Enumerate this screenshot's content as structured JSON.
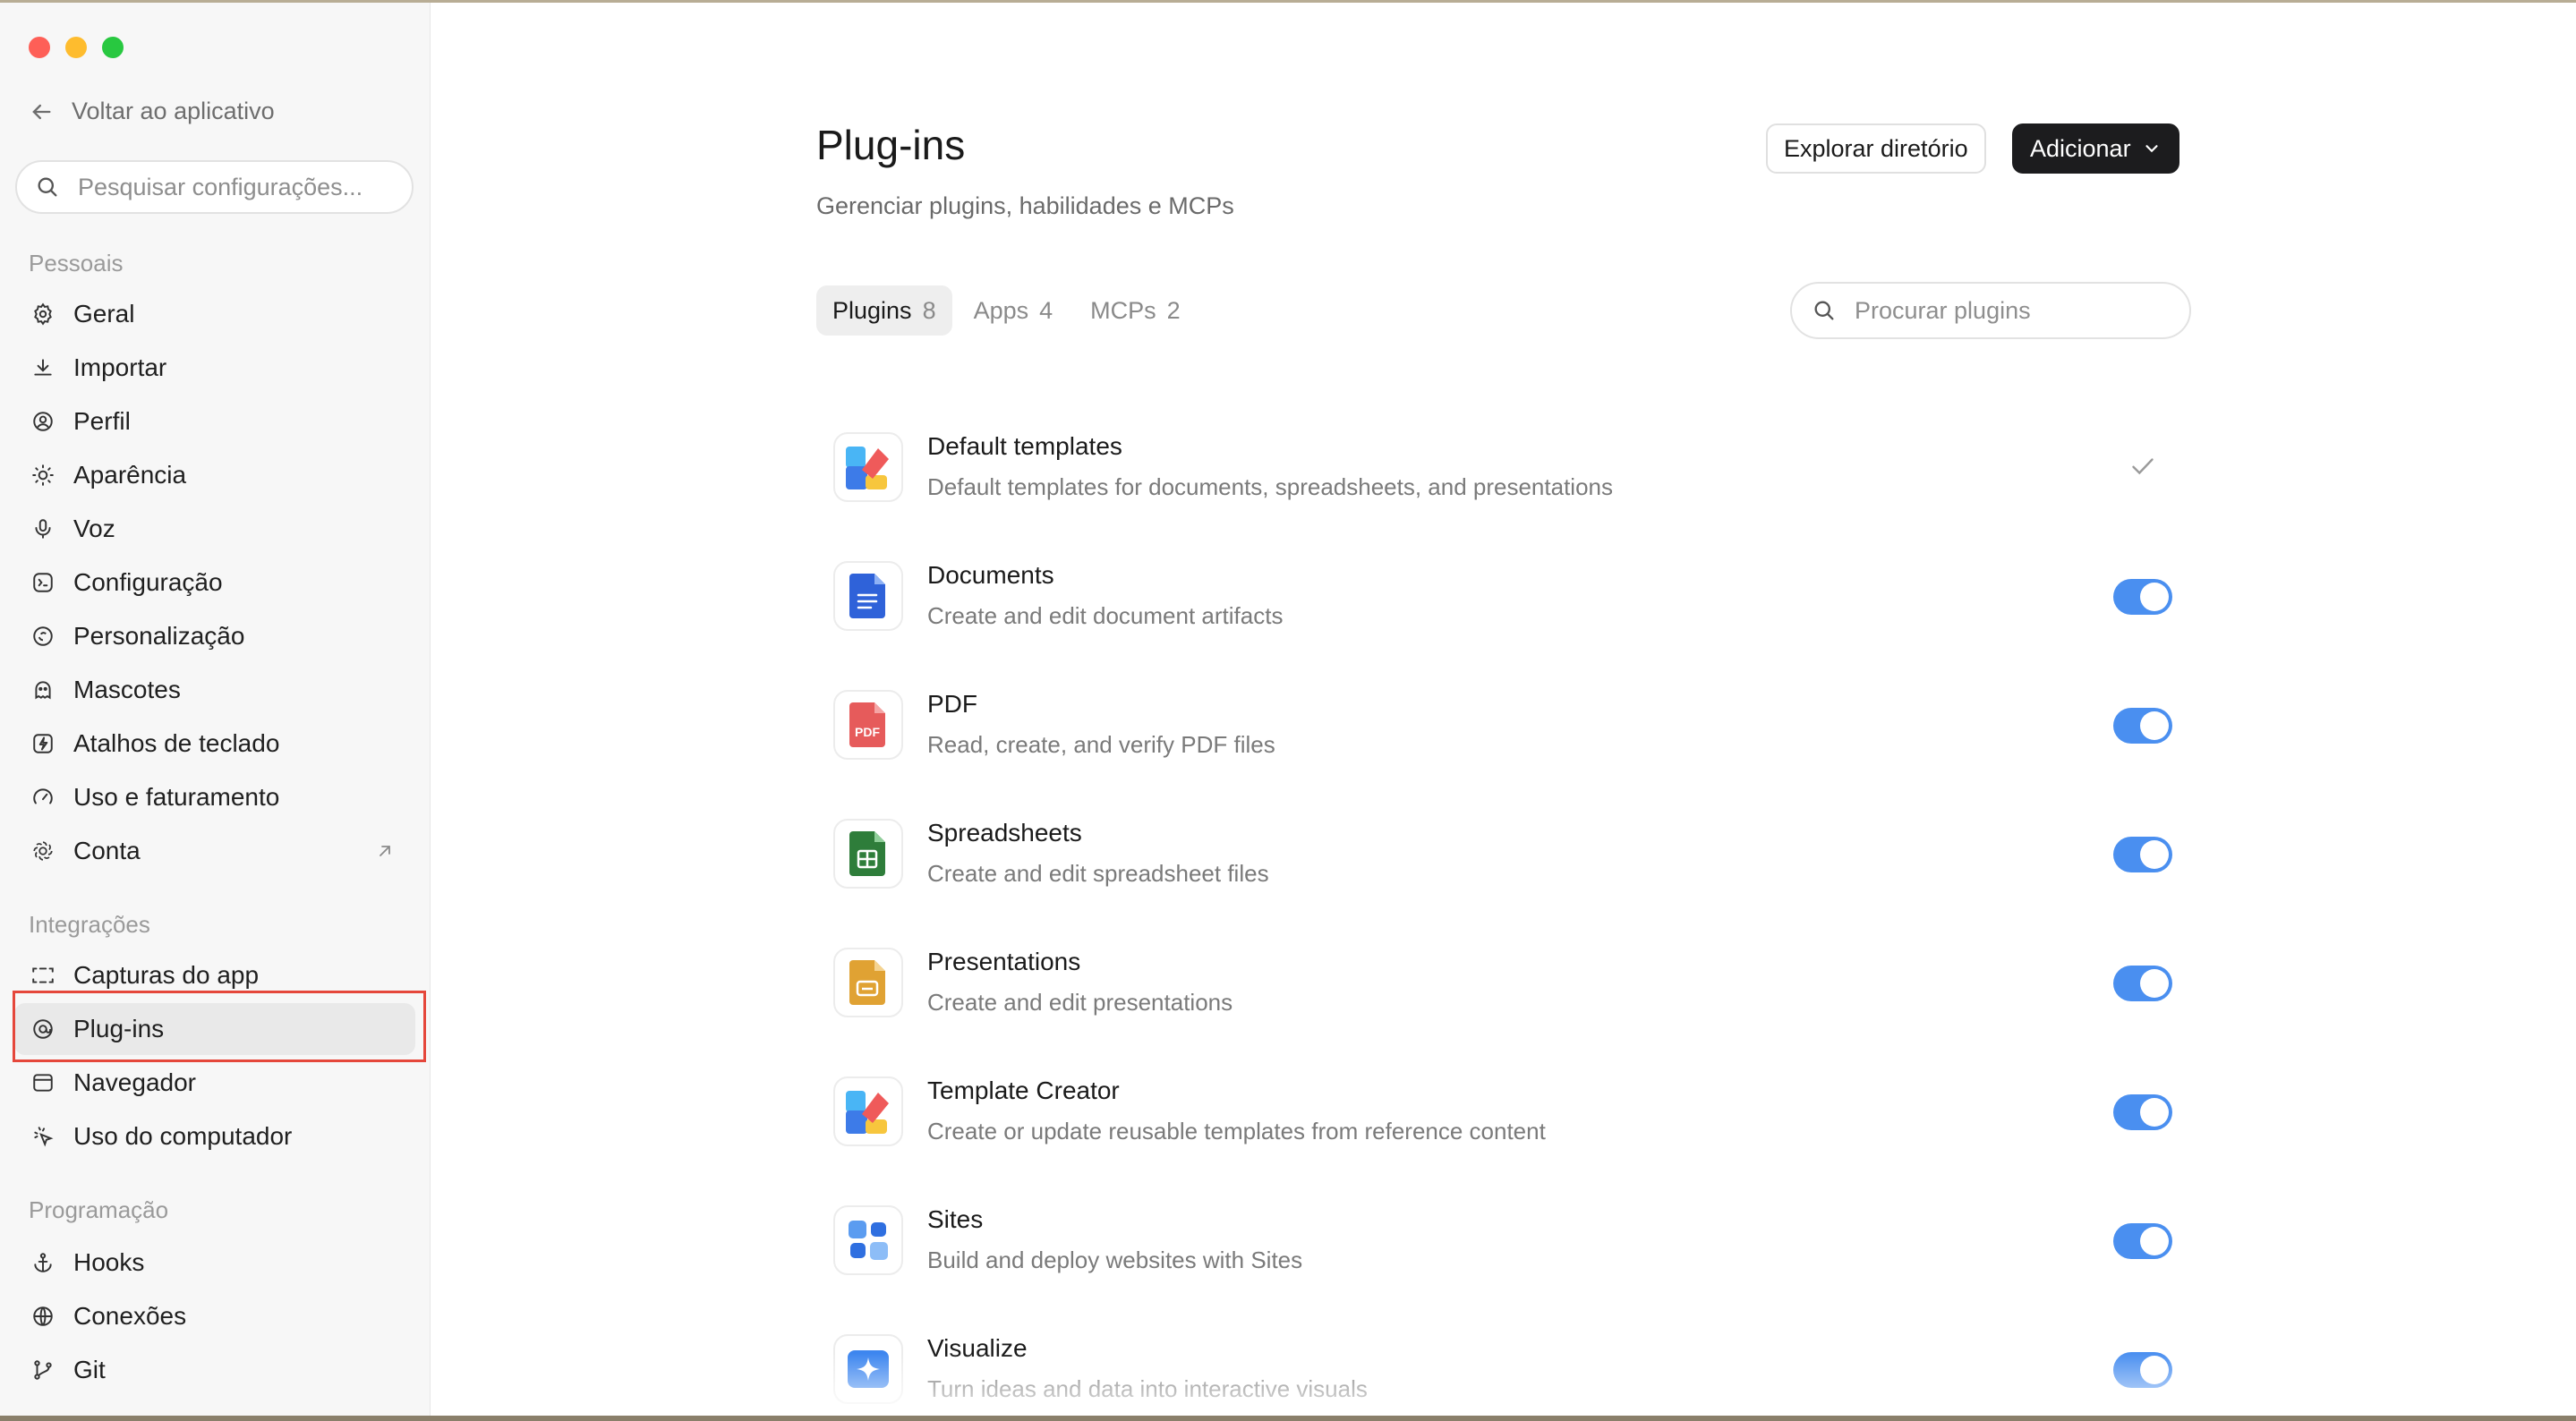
{
  "sidebar": {
    "back_label": "Voltar ao aplicativo",
    "search_placeholder": "Pesquisar configurações...",
    "sections": [
      {
        "label": "Pessoais",
        "items": [
          {
            "label": "Geral",
            "icon": "gear-icon"
          },
          {
            "label": "Importar",
            "icon": "download-icon"
          },
          {
            "label": "Perfil",
            "icon": "profile-icon"
          },
          {
            "label": "Aparência",
            "icon": "sun-icon"
          },
          {
            "label": "Voz",
            "icon": "microphone-icon"
          },
          {
            "label": "Configuração",
            "icon": "config-icon"
          },
          {
            "label": "Personalização",
            "icon": "personalize-icon"
          },
          {
            "label": "Mascotes",
            "icon": "mascot-icon"
          },
          {
            "label": "Atalhos de teclado",
            "icon": "keyboard-shortcut-icon"
          },
          {
            "label": "Uso e faturamento",
            "icon": "gauge-icon"
          },
          {
            "label": "Conta",
            "icon": "account-icon",
            "external": "arrow-up-right-icon"
          }
        ]
      },
      {
        "label": "Integrações",
        "items": [
          {
            "label": "Capturas do app",
            "icon": "capture-icon"
          },
          {
            "label": "Plug-ins",
            "icon": "plugin-icon",
            "active": true
          },
          {
            "label": "Navegador",
            "icon": "browser-icon"
          },
          {
            "label": "Uso do computador",
            "icon": "cursor-icon"
          }
        ]
      },
      {
        "label": "Programação",
        "items": [
          {
            "label": "Hooks",
            "icon": "anchor-icon"
          },
          {
            "label": "Conexões",
            "icon": "globe-icon"
          },
          {
            "label": "Git",
            "icon": "git-branch-icon"
          }
        ]
      }
    ]
  },
  "header": {
    "title": "Plug-ins",
    "subtitle": "Gerenciar plugins, habilidades e MCPs",
    "explore_button": "Explorar diretório",
    "add_button": "Adicionar"
  },
  "tabs": [
    {
      "label": "Plugins",
      "count": "8",
      "active": true
    },
    {
      "label": "Apps",
      "count": "4"
    },
    {
      "label": "MCPs",
      "count": "2"
    }
  ],
  "plugin_search_placeholder": "Procurar plugins",
  "plugins": [
    {
      "name": "Default templates",
      "description": "Default templates for documents, spreadsheets, and presentations",
      "state": "installed-check"
    },
    {
      "name": "Documents",
      "description": "Create and edit document artifacts",
      "state": "on"
    },
    {
      "name": "PDF",
      "description": "Read, create, and verify PDF files",
      "state": "on",
      "icon_text": "PDF"
    },
    {
      "name": "Spreadsheets",
      "description": "Create and edit spreadsheet files",
      "state": "on"
    },
    {
      "name": "Presentations",
      "description": "Create and edit presentations",
      "state": "on"
    },
    {
      "name": "Template Creator",
      "description": "Create or update reusable templates from reference content",
      "state": "on"
    },
    {
      "name": "Sites",
      "description": "Build and deploy websites with Sites",
      "state": "on"
    },
    {
      "name": "Visualize",
      "description": "Turn ideas and data into interactive visuals",
      "state": "on"
    }
  ],
  "colors": {
    "toggle_on": "#4a8ff0",
    "highlight": "#e5473b",
    "dark_button": "#1c1c1e"
  }
}
